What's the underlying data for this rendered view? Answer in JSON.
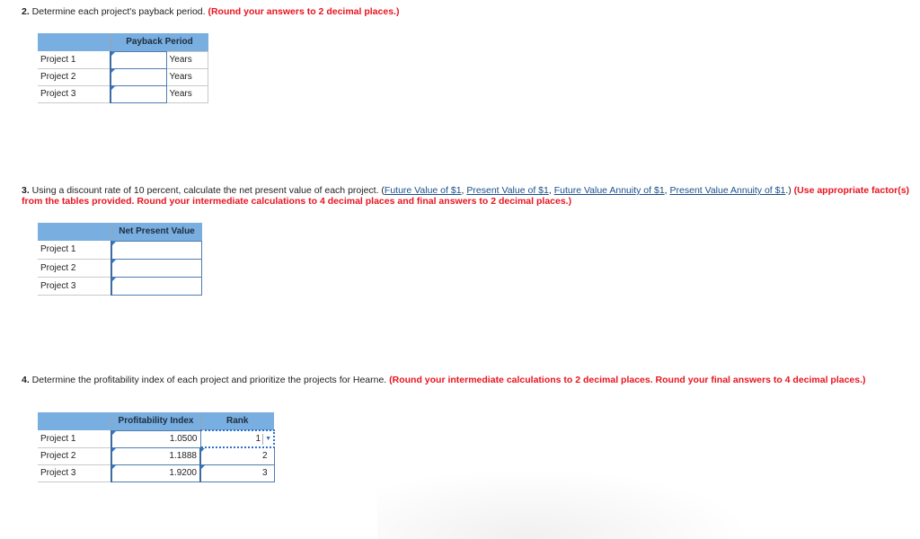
{
  "q2": {
    "num": "2.",
    "text": " Determine each project's payback period. ",
    "instruction": "(Round your answers to 2 decimal places.)",
    "table": {
      "header": "Payback Period",
      "rows": [
        {
          "label": "Project 1",
          "value": "",
          "unit": "Years"
        },
        {
          "label": "Project 2",
          "value": "",
          "unit": "Years"
        },
        {
          "label": "Project 3",
          "value": "",
          "unit": "Years"
        }
      ]
    }
  },
  "q3": {
    "num": "3.",
    "text": " Using a discount rate of 10 percent, calculate the net present value of each project. (",
    "links": [
      "Future Value of $1",
      "Present Value of $1",
      "Future Value Annuity of $1",
      "Present Value Annuity of $1"
    ],
    "sep": ", ",
    "after_links": ".) ",
    "instruction": "(Use appropriate factor(s) from the tables provided. Round your intermediate calculations to 4 decimal places and final answers to 2 decimal places.)",
    "table": {
      "header": "Net Present Value",
      "rows": [
        {
          "label": "Project 1",
          "value": ""
        },
        {
          "label": "Project 2",
          "value": ""
        },
        {
          "label": "Project 3",
          "value": ""
        }
      ]
    }
  },
  "q4": {
    "num": "4.",
    "text": " Determine the profitability index of each project and prioritize the projects for Hearne. ",
    "instruction": "(Round your intermediate calculations to 2 decimal places. Round your final answers to 4 decimal places.)",
    "table": {
      "headers": [
        "Profitability Index",
        "Rank"
      ],
      "rows": [
        {
          "label": "Project 1",
          "pi": "1.0500",
          "rank": "1"
        },
        {
          "label": "Project 2",
          "pi": "1.1888",
          "rank": "2"
        },
        {
          "label": "Project 3",
          "pi": "1.9200",
          "rank": "3"
        }
      ]
    }
  },
  "icons": {
    "dropdown": "▼"
  }
}
